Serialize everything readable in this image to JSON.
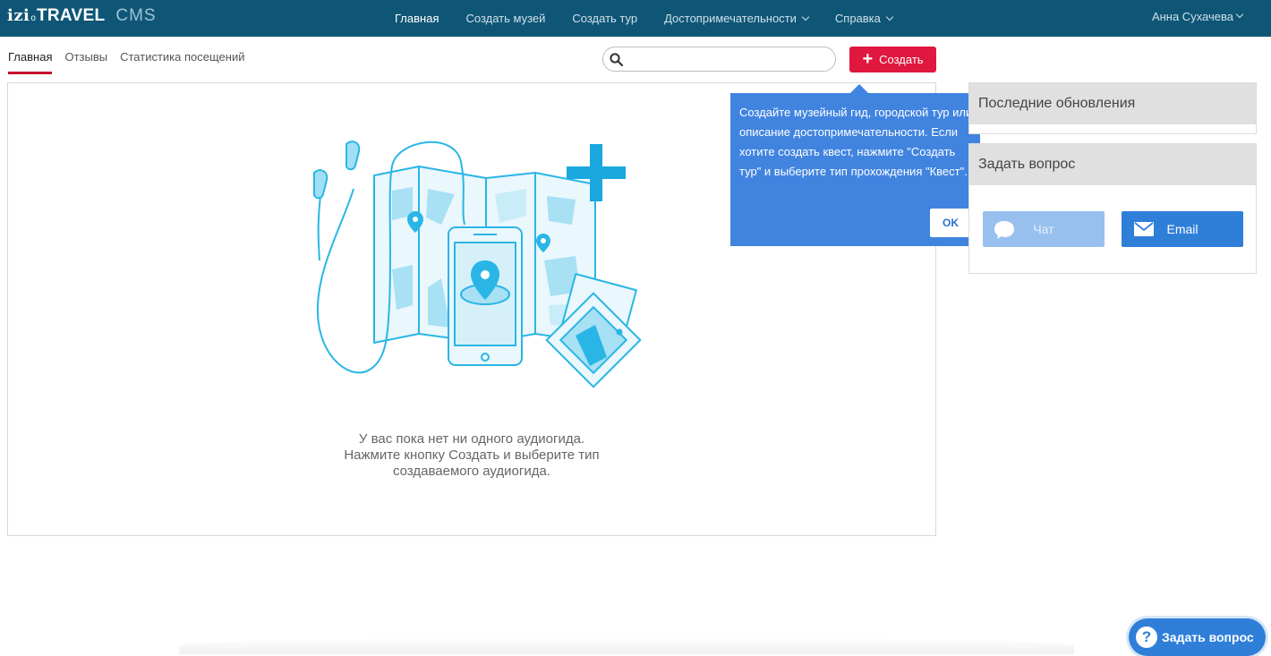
{
  "brand": {
    "izi": "izi",
    "dot": "o",
    "travel": "TRAVEL",
    "cms": "CMS"
  },
  "nav": {
    "items": [
      {
        "label": "Главная"
      },
      {
        "label": "Создать музей"
      },
      {
        "label": "Создать тур"
      },
      {
        "label": "Достопримечательности"
      },
      {
        "label": "Справка"
      }
    ],
    "user": "Анна Сухачева"
  },
  "tabs": [
    {
      "label": "Главная"
    },
    {
      "label": "Отзывы"
    },
    {
      "label": "Статистика посещений"
    }
  ],
  "search": {
    "value": "",
    "placeholder": ""
  },
  "create_button": {
    "label": "Создать"
  },
  "empty_state": {
    "lines": [
      "У вас пока нет ни одного аудиогида.",
      "Нажмите кнопку Создать и выберите тип",
      "создаваемого аудиогида."
    ]
  },
  "tooltip": {
    "text": "Создайте музейный гид, городской тур или описание достопримечательности. Если хотите создать квест, нажмите \"Создать тур\" и выберите тип прохождения \"Квест\".",
    "ok": "OK"
  },
  "sidebar": {
    "updates_title": "Последние обновления",
    "ask_title": "Задать вопрос",
    "chat_label": "Чат",
    "email_label": "Email"
  },
  "help_fab": {
    "label": "Задать вопрос",
    "icon": "?"
  },
  "colors": {
    "topbar": "#0f5676",
    "accent": "#e0173e",
    "tooltip": "#4184e0",
    "email": "#2f7fd9",
    "chat": "#98c0ee",
    "illustration": "#29b6e6"
  },
  "icons": [
    "search-icon",
    "plus-icon",
    "chevron-down-icon",
    "chat-bubble-icon",
    "envelope-icon",
    "question-icon"
  ]
}
